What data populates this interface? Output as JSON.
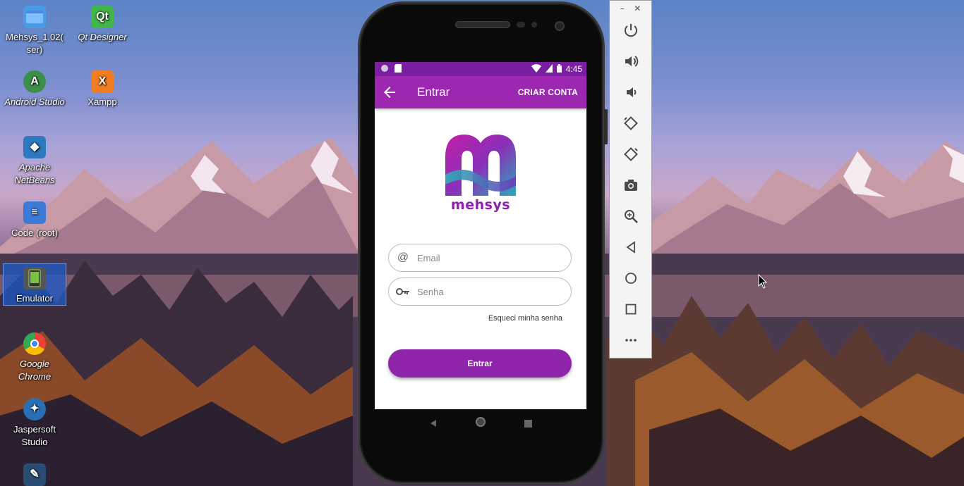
{
  "desktop": {
    "icons": [
      {
        "label": "Mehsys_1.02(\nser)",
        "icon": "folder-icon"
      },
      {
        "label": "Qt Designer",
        "icon": "qt-designer-icon"
      },
      {
        "label": "Android Studio",
        "icon": "android-studio-icon"
      },
      {
        "label": "Xampp",
        "icon": "xampp-icon"
      },
      {
        "label": "Apache NetBeans",
        "icon": "netbeans-icon"
      },
      {
        "label": "Code (root)",
        "icon": "code-icon"
      },
      {
        "label": "Emulator",
        "icon": "emulator-icon"
      },
      {
        "label": "Google Chrome",
        "icon": "chrome-icon"
      },
      {
        "label": "Jaspersoft Studio",
        "icon": "jaspersoft-icon"
      }
    ]
  },
  "phone": {
    "status": {
      "time": "4:45"
    },
    "appbar": {
      "title": "Entrar",
      "action": "CRIAR CONTA"
    },
    "logo_text": "mehsys",
    "form": {
      "email_placeholder": "Email",
      "password_placeholder": "Senha",
      "forgot_label": "Esqueci minha senha",
      "submit_label": "Entrar"
    }
  },
  "emulator_toolbar": {
    "minimize": "–",
    "close": "✕",
    "buttons": [
      "power-icon",
      "volume-up-icon",
      "volume-down-icon",
      "rotate-left-icon",
      "rotate-right-icon",
      "camera-icon",
      "zoom-icon",
      "back-icon",
      "home-icon",
      "overview-icon",
      "more-icon"
    ]
  },
  "colors": {
    "primary": "#9c27b0",
    "primary_dark": "#7b1fa2",
    "button": "#8e24aa"
  }
}
